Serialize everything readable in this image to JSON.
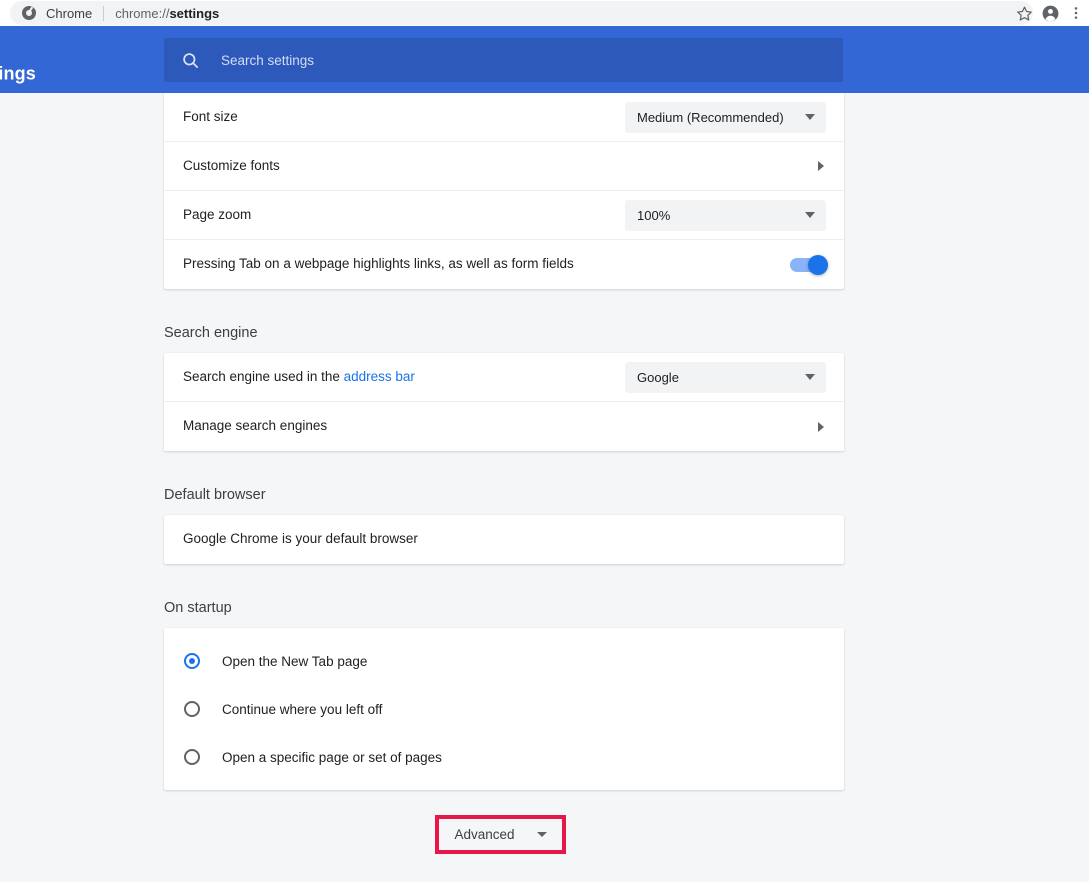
{
  "browser": {
    "logo_icon": "chrome-logo-icon",
    "brand": "Chrome",
    "url_prefix": "chrome://",
    "url_bold": "settings",
    "bookmark_icon": "star-icon",
    "profile_icon": "account-avatar-icon",
    "menu_icon": "three-dot-menu-icon"
  },
  "header": {
    "title": "Settings",
    "accent_color": "#3367d6",
    "search": {
      "icon": "search-icon",
      "placeholder": "Search settings",
      "value": ""
    }
  },
  "appearance": {
    "rows": [
      {
        "label": "Font size",
        "control": "dropdown",
        "value": "Medium (Recommended)"
      },
      {
        "label": "Customize fonts",
        "control": "subpage"
      },
      {
        "label": "Page zoom",
        "control": "dropdown",
        "value": "100%"
      },
      {
        "label": "Pressing Tab on a webpage highlights links, as well as form fields",
        "control": "toggle",
        "value": "on"
      }
    ]
  },
  "search_engine": {
    "title": "Search engine",
    "rows": [
      {
        "label_pre": "Search engine used in the ",
        "link": "address bar",
        "control": "dropdown",
        "value": "Google"
      },
      {
        "label": "Manage search engines",
        "control": "subpage"
      }
    ]
  },
  "default_browser": {
    "title": "Default browser",
    "status": "Google Chrome is your default browser"
  },
  "on_startup": {
    "title": "On startup",
    "options": [
      {
        "label": "Open the New Tab page",
        "selected": true
      },
      {
        "label": "Continue where you left off",
        "selected": false
      },
      {
        "label": "Open a specific page or set of pages",
        "selected": false
      }
    ]
  },
  "advanced": {
    "label": "Advanced",
    "caret_icon": "chevron-down-icon",
    "highlight_color": "#e8174a"
  }
}
